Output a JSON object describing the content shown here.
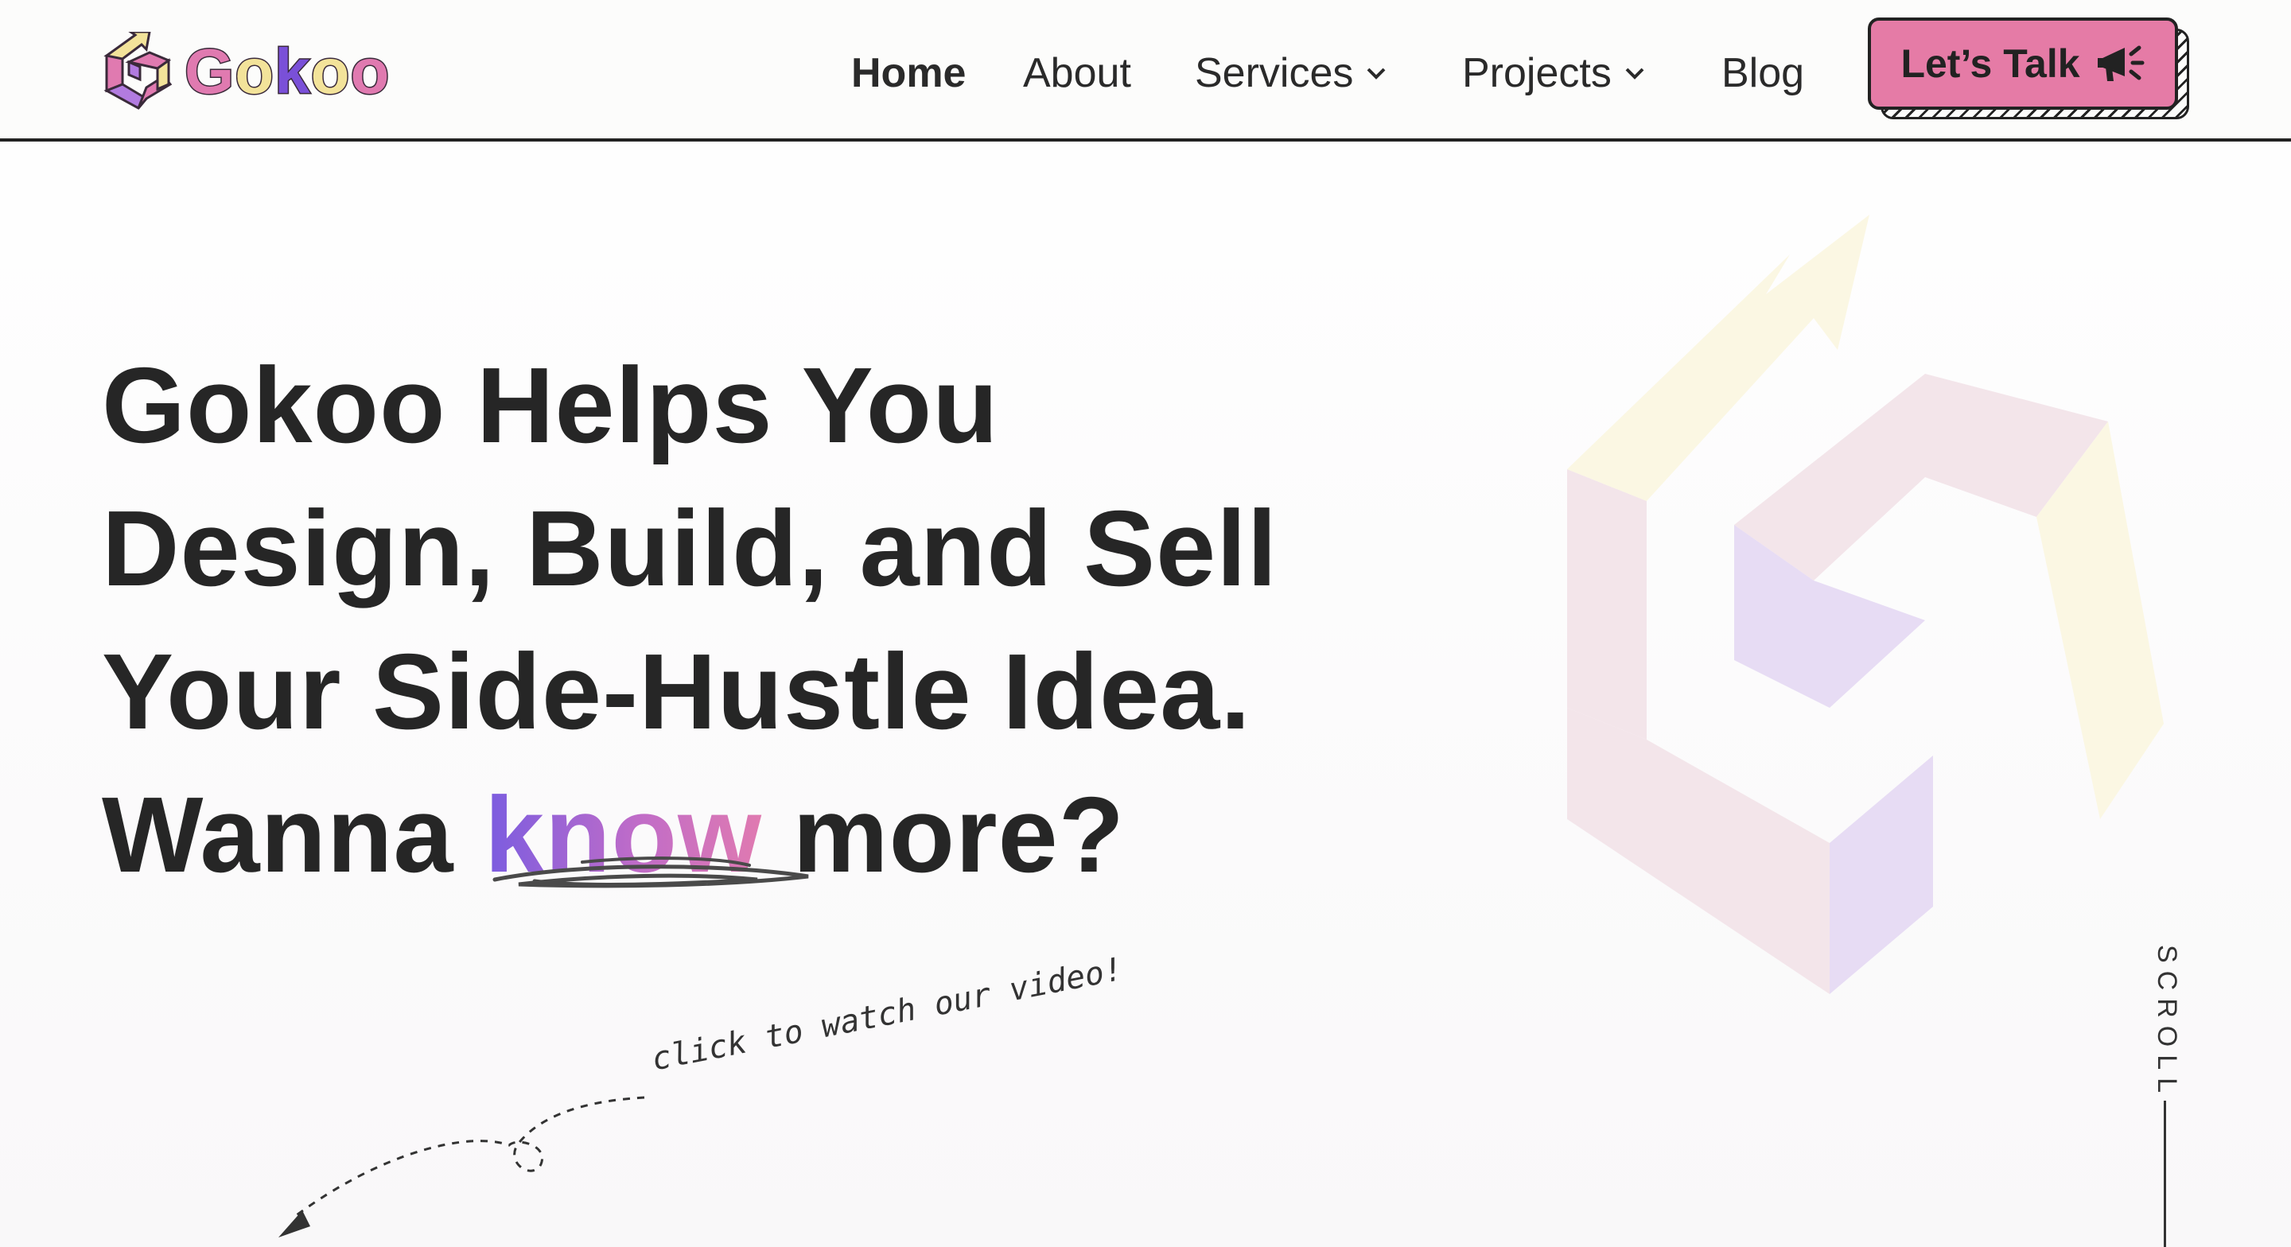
{
  "brand": {
    "name_letters": [
      "G",
      "o",
      "k",
      "o",
      "o"
    ],
    "logo_icon": "gokoo-hexagon-arrow-logo",
    "colors": {
      "pink": "#e07ab0",
      "yellow": "#f3e39a",
      "purple": "#7a50d8"
    }
  },
  "nav": {
    "items": [
      {
        "label": "Home",
        "active": true,
        "dropdown": false
      },
      {
        "label": "About",
        "active": false,
        "dropdown": false
      },
      {
        "label": "Services",
        "active": false,
        "dropdown": true,
        "icon": "chevron-down-icon"
      },
      {
        "label": "Projects",
        "active": false,
        "dropdown": true,
        "icon": "chevron-down-icon"
      },
      {
        "label": "Blog",
        "active": false,
        "dropdown": false
      }
    ],
    "cta": {
      "label": "Let’s Talk",
      "icon": "megaphone-icon",
      "color": "#e57ba6"
    }
  },
  "hero": {
    "line1": "Gokoo Helps You",
    "line2": "Design, Build, and Sell",
    "line3": "Your Side-Hustle Idea.",
    "line4_before": "Wanna ",
    "line4_accent": "know",
    "line4_after": " more?",
    "accent_gradient": [
      "#7a5ce0",
      "#e07ab0"
    ]
  },
  "video_hint": {
    "text": "click to watch our video!",
    "icon": "dashed-arrow-icon"
  },
  "scroll": {
    "label": "SCROLL"
  }
}
